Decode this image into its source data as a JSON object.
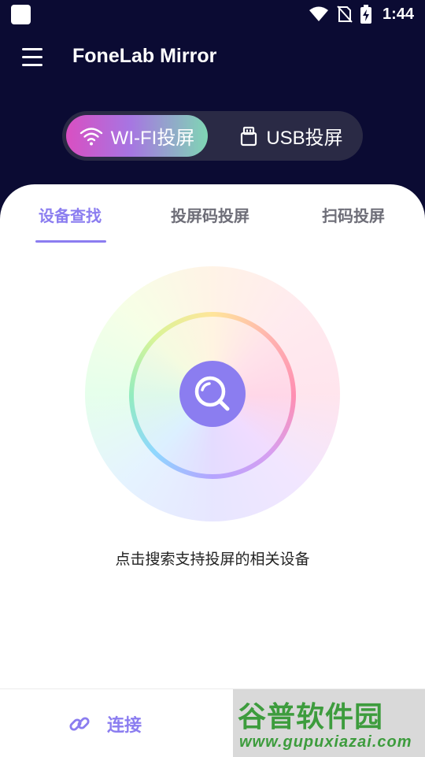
{
  "status": {
    "time": "1:44"
  },
  "app": {
    "title": "FoneLab Mirror"
  },
  "modes": {
    "wifi_label": "WI-FI投屏",
    "usb_label": "USB投屏"
  },
  "tabs": [
    {
      "label": "设备查找"
    },
    {
      "label": "投屏码投屏"
    },
    {
      "label": "扫码投屏"
    }
  ],
  "main": {
    "hint": "点击搜索支持投屏的相关设备"
  },
  "bottom": {
    "connect_label": "连接"
  },
  "watermark": {
    "title": "谷普软件园",
    "url": "www.gupuxiazai.com"
  },
  "colors": {
    "accent": "#8b7df0",
    "header_bg": "#0b0b33"
  },
  "icons": {
    "menu": "menu-icon",
    "wifi": "wifi-icon",
    "usb": "usb-icon",
    "search": "search-icon",
    "link": "link-icon"
  }
}
